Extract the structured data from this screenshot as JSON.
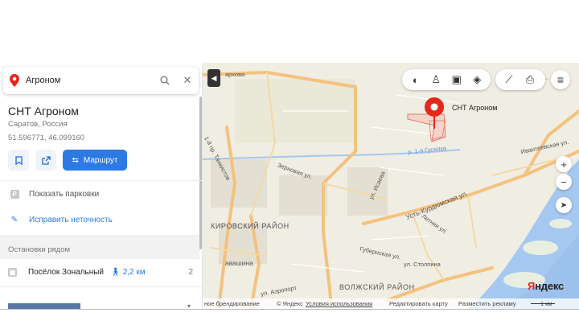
{
  "search": {
    "query": "Агроном"
  },
  "place": {
    "title": "СНТ Агроном",
    "subtitle": "Саратов, Россия",
    "coords": "51.596771, 46.099160",
    "route_label": "Маршрут"
  },
  "actions": {
    "parking_label": "Показать парковки",
    "edit_label": "Исправить неточность"
  },
  "stops": {
    "section_title": "Остановки рядом",
    "items": [
      {
        "name": "Посёлок Зональный",
        "distance": "2,2 км",
        "count": "2"
      }
    ]
  },
  "map": {
    "marker_label": "СНТ Агроном",
    "labels": {
      "top_street": "архова",
      "tanichev": "1-й пр. Танкистов",
      "zernovaya": "Зерновая ул.",
      "isaeva": "ул. Исаева",
      "river": "р. 1-я Гуселка",
      "ivanteevskaya": "Ивантеевская ул.",
      "ust_kurdyum": "Усть-Курдюмская ул.",
      "letnyaya": "Летняя ул.",
      "gubernskaya": "Губернская ул.",
      "stolpina": "ул. Столпина",
      "airport": "ул. Аэропорт",
      "kirov": "КИРОВСКИЙ РАЙОН",
      "volzh": "ВОЛЖСКИЙ РАЙОН",
      "avashina": "авашина"
    },
    "scale": "1 км",
    "logo_prefix": "Я",
    "logo_rest": "ндекс"
  },
  "footer": {
    "branding": "ное брендирование",
    "copyright": "© Яндекс",
    "terms": "Условия использования",
    "edit_map": "Редактировать карту",
    "ad": "Разместить рекламу"
  },
  "colors": {
    "accent": "#2c7ae3",
    "marker": "#e8261d",
    "road": "#f3c27f",
    "water": "#a5c8f0"
  }
}
